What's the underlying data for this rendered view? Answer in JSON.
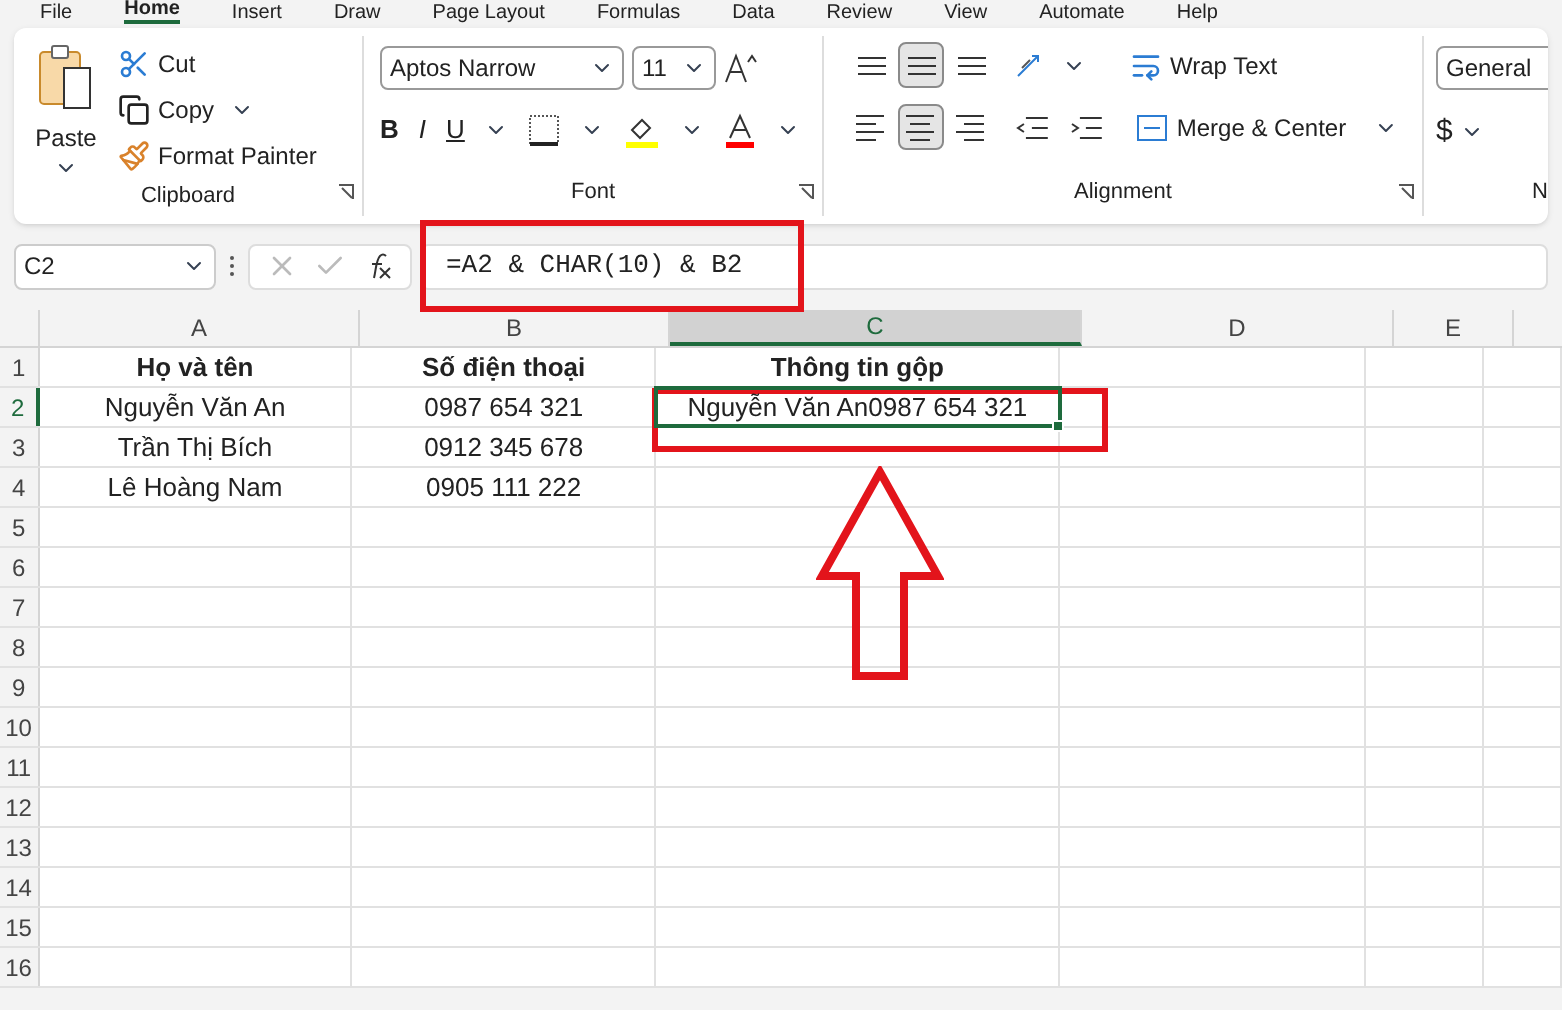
{
  "menu_tabs": [
    {
      "label": "File",
      "selected": false
    },
    {
      "label": "Home",
      "selected": true
    },
    {
      "label": "Insert",
      "selected": false
    },
    {
      "label": "Draw",
      "selected": false
    },
    {
      "label": "Page Layout",
      "selected": false
    },
    {
      "label": "Formulas",
      "selected": false
    },
    {
      "label": "Data",
      "selected": false
    },
    {
      "label": "Review",
      "selected": false
    },
    {
      "label": "View",
      "selected": false
    },
    {
      "label": "Automate",
      "selected": false
    },
    {
      "label": "Help",
      "selected": false
    }
  ],
  "ribbon": {
    "clipboard": {
      "paste": "Paste",
      "cut": "Cut",
      "copy": "Copy",
      "format_painter": "Format Painter",
      "label": "Clipboard"
    },
    "font": {
      "name": "Aptos Narrow",
      "size": "11",
      "bold": "B",
      "italic": "I",
      "underline": "U",
      "label": "Font"
    },
    "alignment": {
      "wrap_text": "Wrap Text",
      "merge_center": "Merge & Center",
      "label": "Alignment",
      "middle_selected": true,
      "center_selected": true
    },
    "number": {
      "format": "General",
      "currency": "$",
      "label": "N"
    }
  },
  "formula_bar": {
    "name_box": "C2",
    "formula": "=A2 & CHAR(10) & B2"
  },
  "sheet": {
    "columns": [
      {
        "label": "A",
        "selected": false
      },
      {
        "label": "B",
        "selected": false
      },
      {
        "label": "C",
        "selected": true
      },
      {
        "label": "D",
        "selected": false
      },
      {
        "label": "E",
        "selected": false
      }
    ],
    "header_row": {
      "label": "1",
      "selected": false,
      "cells": [
        "Họ và tên",
        "Số điện thoại",
        "Thông tin gộp"
      ]
    },
    "rows": [
      {
        "label": "2",
        "selected": true,
        "cells": [
          "Nguyễn Văn An",
          "0987 654 321",
          "Nguyễn Văn An0987 654 321"
        ]
      },
      {
        "label": "3",
        "selected": false,
        "cells": [
          "Trần Thị Bích",
          "0912 345 678"
        ]
      },
      {
        "label": "4",
        "selected": false,
        "cells": [
          "Lê Hoàng Nam",
          "0905 111 222"
        ]
      },
      {
        "label": "5",
        "selected": false
      },
      {
        "label": "6",
        "selected": false
      },
      {
        "label": "7",
        "selected": false
      },
      {
        "label": "8",
        "selected": false
      },
      {
        "label": "9",
        "selected": false
      },
      {
        "label": "10",
        "selected": false
      },
      {
        "label": "11",
        "selected": false
      },
      {
        "label": "12",
        "selected": false
      },
      {
        "label": "13",
        "selected": false
      },
      {
        "label": "14",
        "selected": false
      },
      {
        "label": "15",
        "selected": false
      },
      {
        "label": "16",
        "selected": false
      }
    ]
  }
}
